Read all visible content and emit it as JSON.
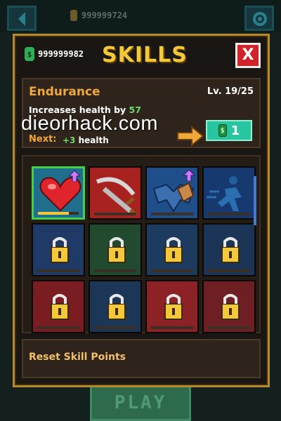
{
  "hud": {
    "coins": "999999724",
    "play_label": "PLAY"
  },
  "panel": {
    "money": "999999982",
    "money_icon_glyph": "$",
    "title": "SKILLS",
    "close_label": "X"
  },
  "skill": {
    "name": "Endurance",
    "level": "Lv. 19/25",
    "desc_prefix": "Increases health by",
    "desc_value": "57",
    "next_label": "Next:",
    "next_value": "+3",
    "next_suffix": "health",
    "upgrade_cost": "1",
    "upgrade_icon_glyph": "$"
  },
  "watermark": "dieorhack.com",
  "tiles": [
    {
      "name": "endurance",
      "state": "unlocked",
      "selected": true,
      "upgrade": true,
      "progress": 0.76,
      "color": "#1f6f8c",
      "icon": "heart-icon"
    },
    {
      "name": "sword",
      "state": "unlocked",
      "selected": false,
      "upgrade": false,
      "progress": 0,
      "color": "#a8231f",
      "icon": "sword-icon"
    },
    {
      "name": "armor",
      "state": "unlocked",
      "selected": false,
      "upgrade": true,
      "progress": 0,
      "color": "#1f4f8a",
      "icon": "armor-icon"
    },
    {
      "name": "speed",
      "state": "unlocked",
      "selected": false,
      "upgrade": false,
      "progress": 0,
      "color": "#163a70",
      "icon": "runner-icon"
    },
    {
      "name": "locked-5",
      "state": "locked",
      "color": "#1f3a66",
      "icon": "lock-icon"
    },
    {
      "name": "locked-6",
      "state": "locked",
      "color": "#214a2e",
      "icon": "lock-icon"
    },
    {
      "name": "locked-7",
      "state": "locked",
      "color": "#1d3b5e",
      "icon": "lock-icon"
    },
    {
      "name": "locked-8",
      "state": "locked",
      "color": "#1c3556",
      "icon": "lock-icon"
    },
    {
      "name": "locked-9",
      "state": "locked",
      "color": "#7a1d22",
      "icon": "lock-icon"
    },
    {
      "name": "locked-10",
      "state": "locked",
      "color": "#1c3658",
      "icon": "lock-icon"
    },
    {
      "name": "locked-11",
      "state": "locked",
      "color": "#8c2225",
      "icon": "lock-icon"
    },
    {
      "name": "locked-12",
      "state": "locked",
      "color": "#6e1f24",
      "icon": "lock-icon"
    }
  ],
  "reset_label": "Reset Skill Points",
  "colors": {
    "gold": "#f3c83a",
    "orange": "#f0a83a",
    "green_text": "#6fd86a",
    "teal_button": "#27c6a0",
    "close_red": "#d0242a",
    "selected_border": "#41d14a"
  }
}
